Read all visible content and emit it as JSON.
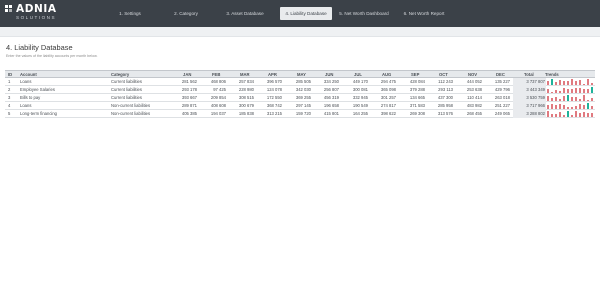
{
  "brand": {
    "name": "ADNIA",
    "sub": "SOLUTIONS"
  },
  "nav": {
    "items": [
      "1. Settings",
      "2. Category",
      "3. Asset Database",
      "4. Liability Database",
      "5. Net Worth Dashboard",
      "6. Net Worth Report"
    ],
    "active_index": 3
  },
  "page": {
    "title": "4. Liability Database",
    "subtitle": "Enter the values of the liability accounts per month below."
  },
  "table": {
    "headers": [
      "ID",
      "Account",
      "Category",
      "JAN",
      "FEB",
      "MAR",
      "APR",
      "MAY",
      "JUN",
      "JUL",
      "AUG",
      "SEP",
      "OCT",
      "NOV",
      "DEC",
      "Total",
      "Trends"
    ],
    "rows": [
      {
        "id": "1",
        "account": "Loans",
        "category": "Current liabilities",
        "values": [
          "281 562",
          "468 806",
          "257 834",
          "396 570",
          "285 505",
          "334 250",
          "449 170",
          "294 475",
          "428 084",
          "112 243",
          "444 052",
          "135 227"
        ],
        "total": "3 737 807"
      },
      {
        "id": "2",
        "account": "Employee Salaries",
        "category": "Current liabilities",
        "values": [
          "293 178",
          "97 425",
          "228 980",
          "124 078",
          "342 030",
          "256 807",
          "300 081",
          "365 098",
          "379 288",
          "293 113",
          "253 638",
          "429 796"
        ],
        "total": "3 443 349"
      },
      {
        "id": "3",
        "account": "Bills to pay",
        "category": "Current liabilities",
        "values": [
          "393 667",
          "209 854",
          "308 515",
          "172 550",
          "369 255",
          "456 319",
          "332 945",
          "301 257",
          "134 665",
          "437 300",
          "110 414",
          "263 018"
        ],
        "total": "3 530 759"
      },
      {
        "id": "4",
        "account": "Loans",
        "category": "Non-current liabilities",
        "values": [
          "289 871",
          "408 608",
          "300 679",
          "368 742",
          "297 145",
          "196 658",
          "190 549",
          "274 817",
          "371 583",
          "285 958",
          "483 982",
          "251 227"
        ],
        "total": "3 717 966"
      },
      {
        "id": "5",
        "account": "Long-term financing",
        "category": "Non-current liabilities",
        "values": [
          "405 385",
          "194 037",
          "185 838",
          "313 215",
          "159 720",
          "415 801",
          "164 255",
          "398 622",
          "269 308",
          "313 576",
          "268 455",
          "249 065"
        ],
        "total": "3 288 802"
      }
    ]
  },
  "colors": {
    "spark_bar": "#e07a80",
    "spark_high": "#1fb29a",
    "header_bg": "#3b4148"
  }
}
